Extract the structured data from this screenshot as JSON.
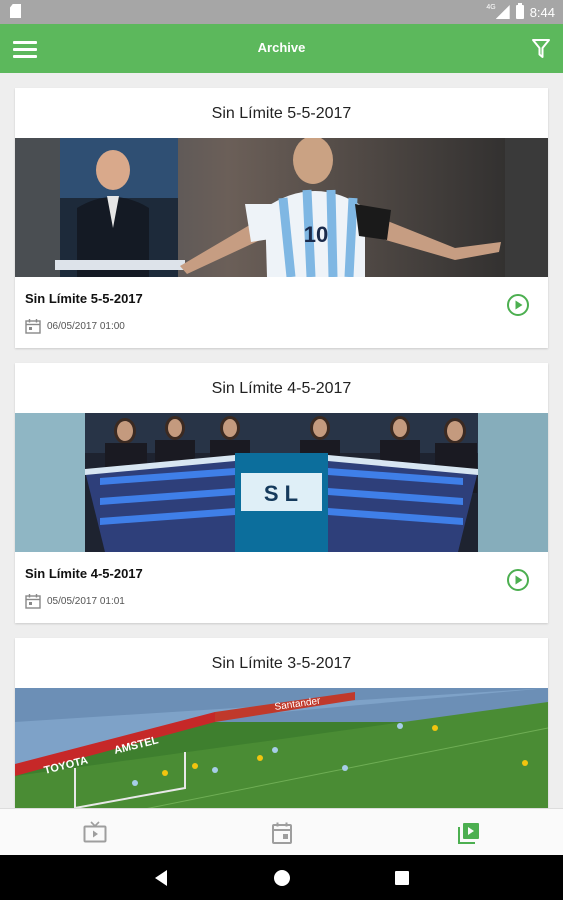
{
  "status_bar": {
    "network": "4G",
    "time": "8:44"
  },
  "app_bar": {
    "title": "Archive"
  },
  "icons": {
    "menu": "hamburger-menu-icon",
    "filter": "filter-funnel-icon",
    "calendar": "calendar-icon",
    "play": "play-circle-icon",
    "live_tv": "tv-icon",
    "schedule": "calendar-icon",
    "archive": "video-library-icon"
  },
  "colors": {
    "accent": "#5cb85c",
    "status_bar": "#a6a6a6",
    "background": "#eeeeee",
    "nav_inactive": "#9e9e9e"
  },
  "cards": [
    {
      "title": "Sin Límite 5-5-2017",
      "name": "Sin Límite 5-5-2017",
      "date": "06/05/2017 01:00",
      "thumbnail": "studio-host-and-soccer-player-celebrating"
    },
    {
      "title": "Sin Límite 4-5-2017",
      "name": "Sin Límite 4-5-2017",
      "date": "05/05/2017 01:01",
      "thumbnail": "tv-studio-panel-desk"
    },
    {
      "title": "Sin Límite 3-5-2017",
      "thumbnail": "soccer-match-stadium"
    }
  ],
  "bottom_nav": {
    "active": "archive"
  }
}
